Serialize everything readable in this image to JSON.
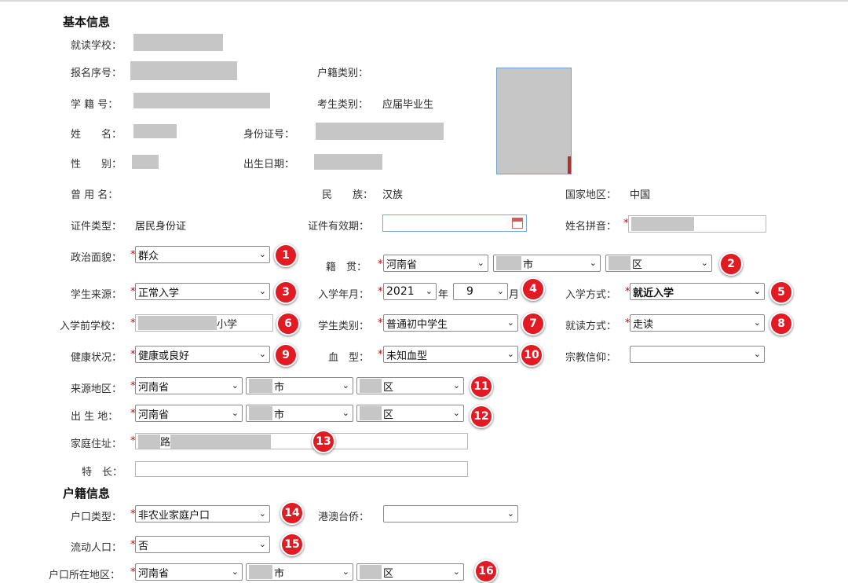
{
  "basic": {
    "section_title": "基本信息",
    "school_label": "就读学校：",
    "reg_no_label": "报名序号：",
    "household_type_label": "户籍类别：",
    "student_no_label": "学 籍 号：",
    "candidate_type_label": "考生类别：",
    "candidate_type_value": "应届毕业生",
    "name_label": "姓　　名：",
    "id_no_label": "身份证号：",
    "gender_label": "性　　别：",
    "birth_label": "出生日期：",
    "former_name_label": "曾 用 名：",
    "ethnicity_label": "民　　族：",
    "ethnicity_value": "汉族",
    "country_label": "国家地区：",
    "country_value": "中国",
    "id_type_label": "证件类型：",
    "id_type_value": "居民身份证",
    "id_validity_label": "证件有效期：",
    "pinyin_label": "姓名拼音："
  },
  "form": {
    "political_label": "政治面貌：",
    "political_value": "群众",
    "native_label": "籍　贯：",
    "native_province": "河南省",
    "native_city_suffix": "市",
    "native_district_suffix": "区",
    "source_label": "学生来源：",
    "source_value": "正常入学",
    "enroll_label": "入学年月：",
    "enroll_year": "2021",
    "year_unit": "年",
    "enroll_month": "9",
    "month_unit": "月",
    "admission_label": "入学方式：",
    "admission_value": "就近入学",
    "prev_school_label": "入学前学校：",
    "prev_school_suffix": "小学",
    "student_type_label": "学生类别：",
    "student_type_value": "普通初中学生",
    "study_mode_label": "就读方式：",
    "study_mode_value": "走读",
    "health_label": "健康状况：",
    "health_value": "健康或良好",
    "blood_label": "血　型：",
    "blood_value": "未知血型",
    "religion_label": "宗教信仰：",
    "religion_value": "",
    "origin_label": "来源地区：",
    "origin_province": "河南省",
    "origin_city_suffix": "市",
    "origin_district_suffix": "区",
    "birthplace_label": "出 生 地：",
    "birthplace_province": "河南省",
    "birthplace_city_suffix": "市",
    "birthplace_district_suffix": "区",
    "address_label": "家庭住址：",
    "address_mid": "路",
    "specialty_label": "特　长：",
    "specialty_value": ""
  },
  "huji": {
    "section_title": "户籍信息",
    "hukou_type_label": "户口类型：",
    "hukou_type_value": "非农业家庭户口",
    "hmt_label": "港澳台侨：",
    "hmt_value": "",
    "floating_label": "流动人口：",
    "floating_value": "否",
    "hukou_region_label": "户口所在地区：",
    "hukou_province": "河南省",
    "hukou_city_suffix": "市",
    "hukou_district_suffix": "区"
  },
  "badges": [
    "1",
    "2",
    "3",
    "4",
    "5",
    "6",
    "7",
    "8",
    "9",
    "10",
    "11",
    "12",
    "13",
    "14",
    "15",
    "16"
  ],
  "colors": {
    "badge": "#e01b24",
    "required": "#d40000",
    "redaction": "#c6c6c6"
  }
}
